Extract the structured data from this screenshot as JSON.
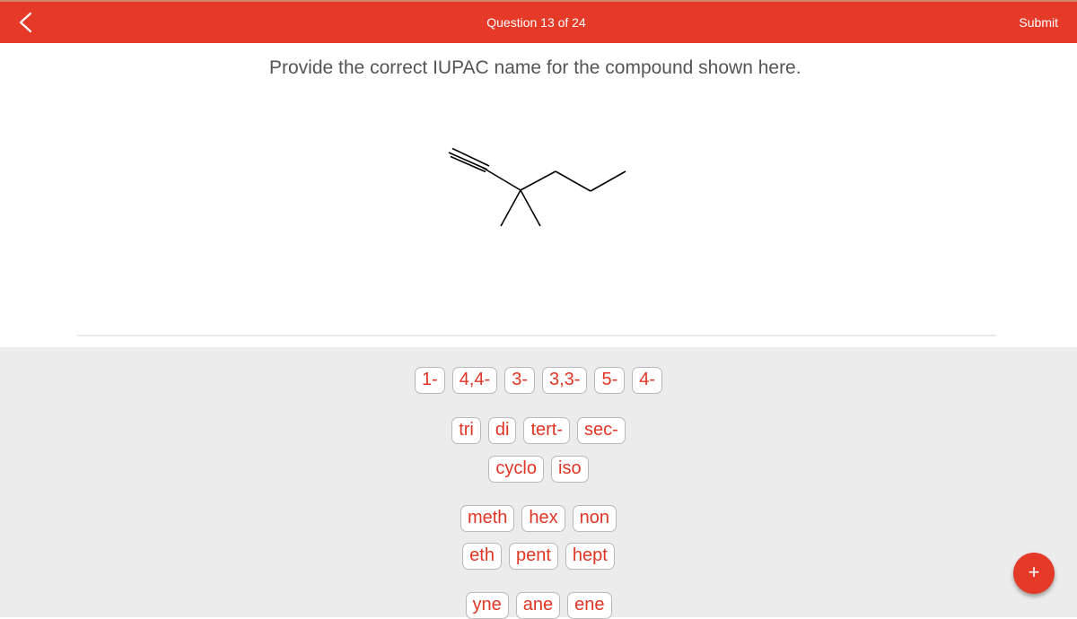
{
  "header": {
    "back_icon": "chevron-left-icon",
    "title": "Question 13 of 24",
    "submit_label": "Submit",
    "color": "#e43a27"
  },
  "question": {
    "prompt": "Provide the correct IUPAC name for the compound shown here.",
    "structure": "3,3-dimethylhex-1-yne skeletal formula"
  },
  "tray": {
    "locants": [
      "1-",
      "4,4-",
      "3-",
      "3,3-",
      "5-",
      "4-"
    ],
    "multipliers": [
      "tri",
      "di",
      "tert-",
      "sec-"
    ],
    "modifiers": [
      "cyclo",
      "iso"
    ],
    "roots_row1": [
      "meth",
      "hex",
      "non"
    ],
    "roots_row2": [
      "eth",
      "pent",
      "hept"
    ],
    "suffixes": [
      "yne",
      "ane",
      "ene"
    ]
  },
  "fab": {
    "label": "+",
    "icon": "plus-icon"
  }
}
